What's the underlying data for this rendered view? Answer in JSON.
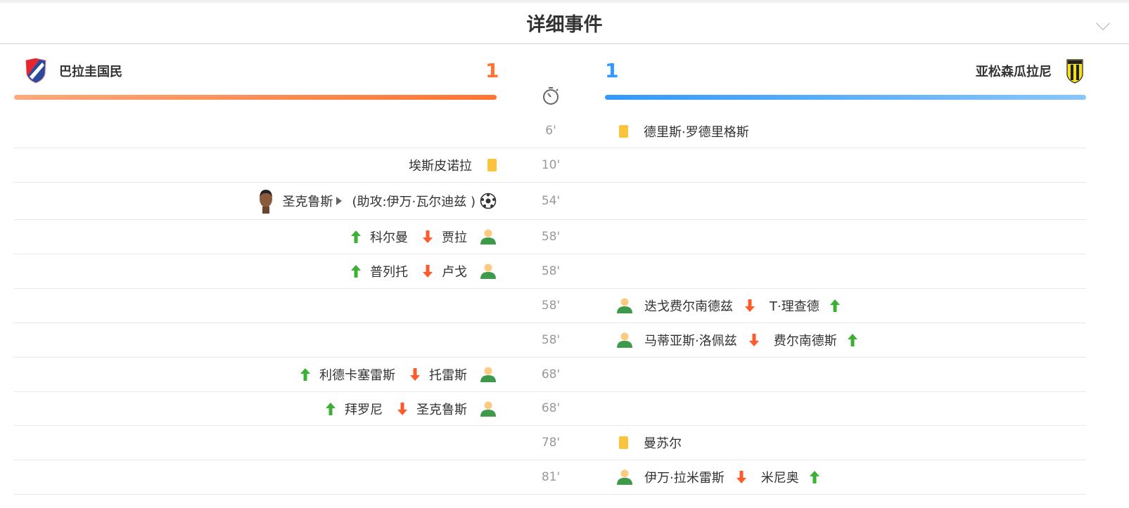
{
  "header": {
    "title": "详细事件"
  },
  "home": {
    "name": "巴拉圭国民",
    "score": "1",
    "color": "#ff7433"
  },
  "away": {
    "name": "亚松森瓜拉尼",
    "score": "1",
    "color": "#3399ff"
  },
  "events": [
    {
      "minute": "6'",
      "side": "right",
      "type": "yellow",
      "player": "德里斯·罗德里格斯"
    },
    {
      "minute": "10'",
      "side": "left",
      "type": "yellow",
      "player": "埃斯皮诺拉"
    },
    {
      "minute": "54'",
      "side": "left",
      "type": "goal",
      "player": "圣克鲁斯",
      "assist": "(助攻:伊万·瓦尔迪兹 )"
    },
    {
      "minute": "58'",
      "side": "left",
      "type": "sub",
      "in": "科尔曼",
      "out": "贾拉"
    },
    {
      "minute": "58'",
      "side": "left",
      "type": "sub",
      "in": "普列托",
      "out": "卢戈"
    },
    {
      "minute": "58'",
      "side": "right",
      "type": "sub",
      "out": "迭戈费尔南德兹",
      "in": "T·理查德"
    },
    {
      "minute": "58'",
      "side": "right",
      "type": "sub",
      "out": "马蒂亚斯·洛佩兹",
      "in": "费尔南德斯"
    },
    {
      "minute": "68'",
      "side": "left",
      "type": "sub",
      "in": "利德卡塞雷斯",
      "out": "托雷斯"
    },
    {
      "minute": "68'",
      "side": "left",
      "type": "sub",
      "in": "拜罗尼",
      "out": "圣克鲁斯"
    },
    {
      "minute": "78'",
      "side": "right",
      "type": "yellow",
      "player": "曼苏尔"
    },
    {
      "minute": "81'",
      "side": "right",
      "type": "sub",
      "out": "伊万·拉米雷斯",
      "in": "米尼奥"
    }
  ]
}
